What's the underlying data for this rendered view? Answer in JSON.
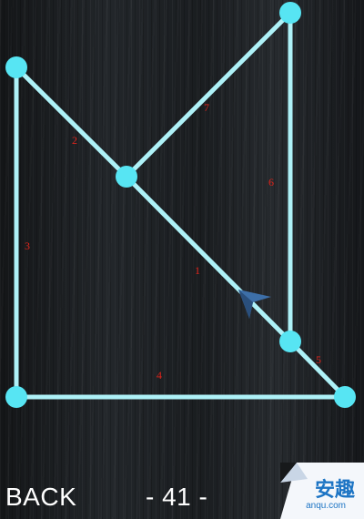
{
  "puzzle": {
    "line_color": "#aef1f7",
    "node_color": "#57e5f3",
    "label_color": "#e0241b",
    "edges": [
      {
        "label": "1"
      },
      {
        "label": "2"
      },
      {
        "label": "3"
      },
      {
        "label": "4"
      },
      {
        "label": "5"
      },
      {
        "label": "6"
      },
      {
        "label": "7"
      }
    ],
    "node_count": 7,
    "cursor": "arrow-cursor-icon"
  },
  "bottom_bar": {
    "back_label": "BACK",
    "level_label": "- 41 -"
  },
  "watermark": {
    "main": "安趣",
    "sub": "anqu.com",
    "color": "#1c74c4"
  }
}
